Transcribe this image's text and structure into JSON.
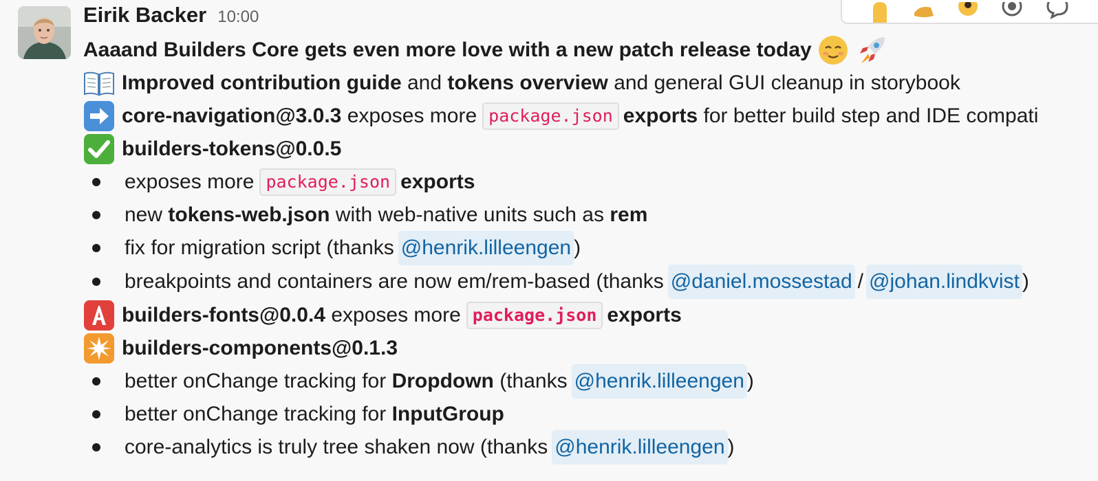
{
  "author": {
    "name": "Eirik Backer",
    "time": "10:00"
  },
  "toolbar": {
    "icons": [
      "raised-hand-emoji-icon",
      "folded-hands-emoji-icon",
      "eyes-emoji-icon",
      "record-icon",
      "reply-in-thread-icon"
    ]
  },
  "message": {
    "headline": "Aaaand Builders Core gets even more love with a new patch release today",
    "headline_emojis": [
      "relieved-face-emoji",
      "rocket-emoji"
    ],
    "line1": {
      "emoji": "open-book-emoji",
      "b1": "Improved contribution guide",
      "t1": "and",
      "b2": "tokens overview",
      "t2": "and general GUI cleanup in storybook"
    },
    "line2": {
      "emoji": "right-arrow-emoji",
      "b1": "core-navigation@3.0.3",
      "t1": "exposes more",
      "code": "package.json",
      "b2": "exports",
      "t2": "for better build step and IDE compati"
    },
    "line3": {
      "emoji": "check-mark-button-emoji",
      "b1": "builders-tokens@0.0.5"
    },
    "tokens_bullets": [
      {
        "t1": "exposes more",
        "code": "package.json",
        "b1": "exports"
      },
      {
        "t1": "new",
        "b1": "tokens-web.json",
        "t2": "with web-native units such as",
        "b2": "rem"
      },
      {
        "t1": "fix for migration script (thanks",
        "mention": "@henrik.lilleengen",
        "t2": ")"
      },
      {
        "t1": "breakpoints and containers are now em/rem-based (thanks",
        "mention1": "@daniel.mossestad",
        "sep": "/",
        "mention2": "@johan.lindkvist",
        "t2": ")"
      }
    ],
    "line4": {
      "emoji": "a-button-blood-type-emoji",
      "b1": "builders-fonts@0.0.4",
      "t1": "exposes more",
      "code": "package.json",
      "b2": "exports"
    },
    "line5": {
      "emoji": "eight-pointed-star-emoji",
      "b1": "builders-components@0.1.3"
    },
    "components_bullets": [
      {
        "t1": "better onChange tracking for",
        "b1": "Dropdown",
        "t2": "(thanks",
        "mention": "@henrik.lilleengen",
        "t3": ")"
      },
      {
        "t1": "better onChange tracking for",
        "b1": "InputGroup"
      },
      {
        "t1": "core-analytics is truly tree shaken now (thanks",
        "mention": "@henrik.lilleengen",
        "t2": ")"
      }
    ]
  },
  "colors": {
    "background": "#f8f8f8",
    "text": "#1d1c1d",
    "timestamp": "#616061",
    "mention_text": "#1264a3",
    "mention_bg": "#e3eef6",
    "code_text": "#e01e5a"
  }
}
